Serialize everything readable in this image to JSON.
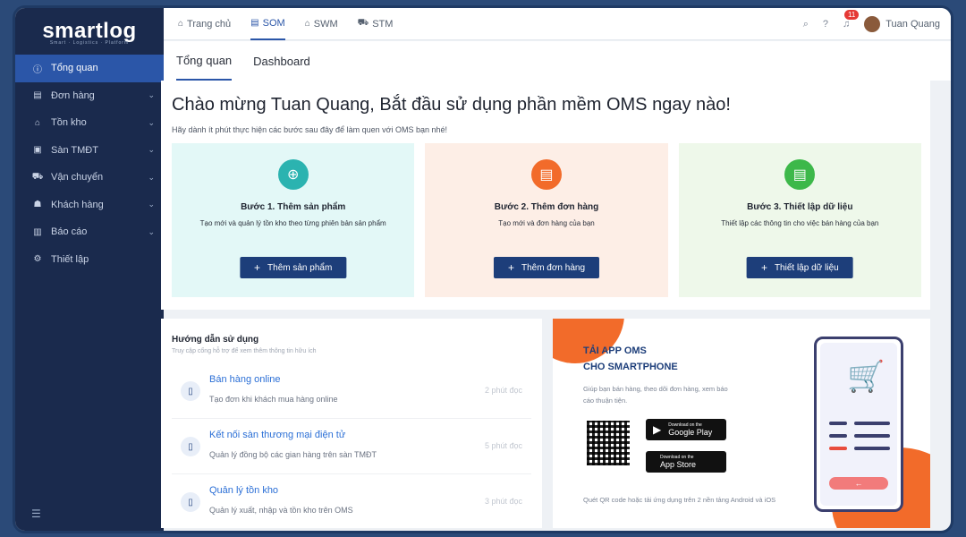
{
  "brand": {
    "logo": "smartlog",
    "tagline": "Smart · Logistics · Platform"
  },
  "sidebar": {
    "items": [
      {
        "label": "Tổng quan",
        "icon": "info-circle-icon",
        "glyph": "ⓘ",
        "chevron": false,
        "active": true
      },
      {
        "label": "Đơn hàng",
        "icon": "order-icon",
        "glyph": "▤",
        "chevron": true
      },
      {
        "label": "Tồn kho",
        "icon": "warehouse-icon",
        "glyph": "⌂",
        "chevron": true
      },
      {
        "label": "Sàn TMĐT",
        "icon": "marketplace-icon",
        "glyph": "▣",
        "chevron": true
      },
      {
        "label": "Vận chuyển",
        "icon": "truck-icon",
        "glyph": "⛟",
        "chevron": true
      },
      {
        "label": "Khách hàng",
        "icon": "customers-icon",
        "glyph": "☗",
        "chevron": true
      },
      {
        "label": "Báo cáo",
        "icon": "report-icon",
        "glyph": "▥",
        "chevron": true
      },
      {
        "label": "Thiết lập",
        "icon": "gear-icon",
        "glyph": "⚙",
        "chevron": false
      }
    ],
    "collapse_glyph": "☰"
  },
  "topbar": {
    "tabs": [
      {
        "label": "Trang chủ",
        "glyph": "⌂"
      },
      {
        "label": "SOM",
        "glyph": "▤",
        "active": true
      },
      {
        "label": "SWM",
        "glyph": "⌂"
      },
      {
        "label": "STM",
        "glyph": "⛟"
      }
    ],
    "notif_count": "11",
    "user_name": "Tuan Quang"
  },
  "subtabs": [
    {
      "label": "Tổng quan",
      "active": true
    },
    {
      "label": "Dashboard"
    }
  ],
  "welcome": {
    "title": "Chào mừng Tuan Quang, Bắt đầu sử dụng phần mềm OMS ngay nào!",
    "subtitle": "Hãy dành ít phút thực hiện các bước sau đây để làm quen với OMS bạn nhé!",
    "steps": [
      {
        "title": "Bước 1. Thêm sản phẩm",
        "desc": "Tạo mới và quản lý tồn kho theo từng phiên bản sản phẩm",
        "button": "Thêm sản phẩm",
        "bg": "#e3f8f7",
        "accent": "#2bb3b0",
        "glyph": "⊕"
      },
      {
        "title": "Bước 2. Thêm đơn hàng",
        "desc": "Tạo mới và đơn hàng của bạn",
        "button": "Thêm đơn hàng",
        "bg": "#fdeee6",
        "accent": "#f26b2a",
        "glyph": "▤"
      },
      {
        "title": "Bước 3. Thiết lập dữ liệu",
        "desc": "Thiết lập các thông tin cho việc bán hàng của bạn",
        "button": "Thiết lập dữ liệu",
        "bg": "#eef8ea",
        "accent": "#3db84a",
        "glyph": "▤"
      }
    ]
  },
  "guide": {
    "title": "Hướng dẫn sử dụng",
    "subtitle": "Truy cập cổng hỗ trợ để xem thêm thông tin hữu ích",
    "items": [
      {
        "title": "Bán hàng online",
        "desc": "Tạo đơn khi khách mua hàng online",
        "time": "2 phút đọc"
      },
      {
        "title": "Kết nối sàn thương mại điện tử",
        "desc": "Quản lý đồng bộ các gian hàng trên sàn TMĐT",
        "time": "5 phút đọc"
      },
      {
        "title": "Quản lý tồn kho",
        "desc": "Quản lý xuất, nhập và tồn kho trên OMS",
        "time": "3 phút đọc"
      }
    ]
  },
  "app_promo": {
    "title_line1": "TẢI APP OMS",
    "title_line2": "CHO SMARTPHONE",
    "desc": "Giúp bạn bán hàng, theo dõi đơn hàng, xem báo cáo thuận tiện.",
    "google_small": "Download on the",
    "google_name": "Google Play",
    "apple_small": "Download on the",
    "apple_name": "App Store",
    "note": "Quét QR code hoặc tải ứng dụng trên 2 nền tảng Android và iOS"
  }
}
